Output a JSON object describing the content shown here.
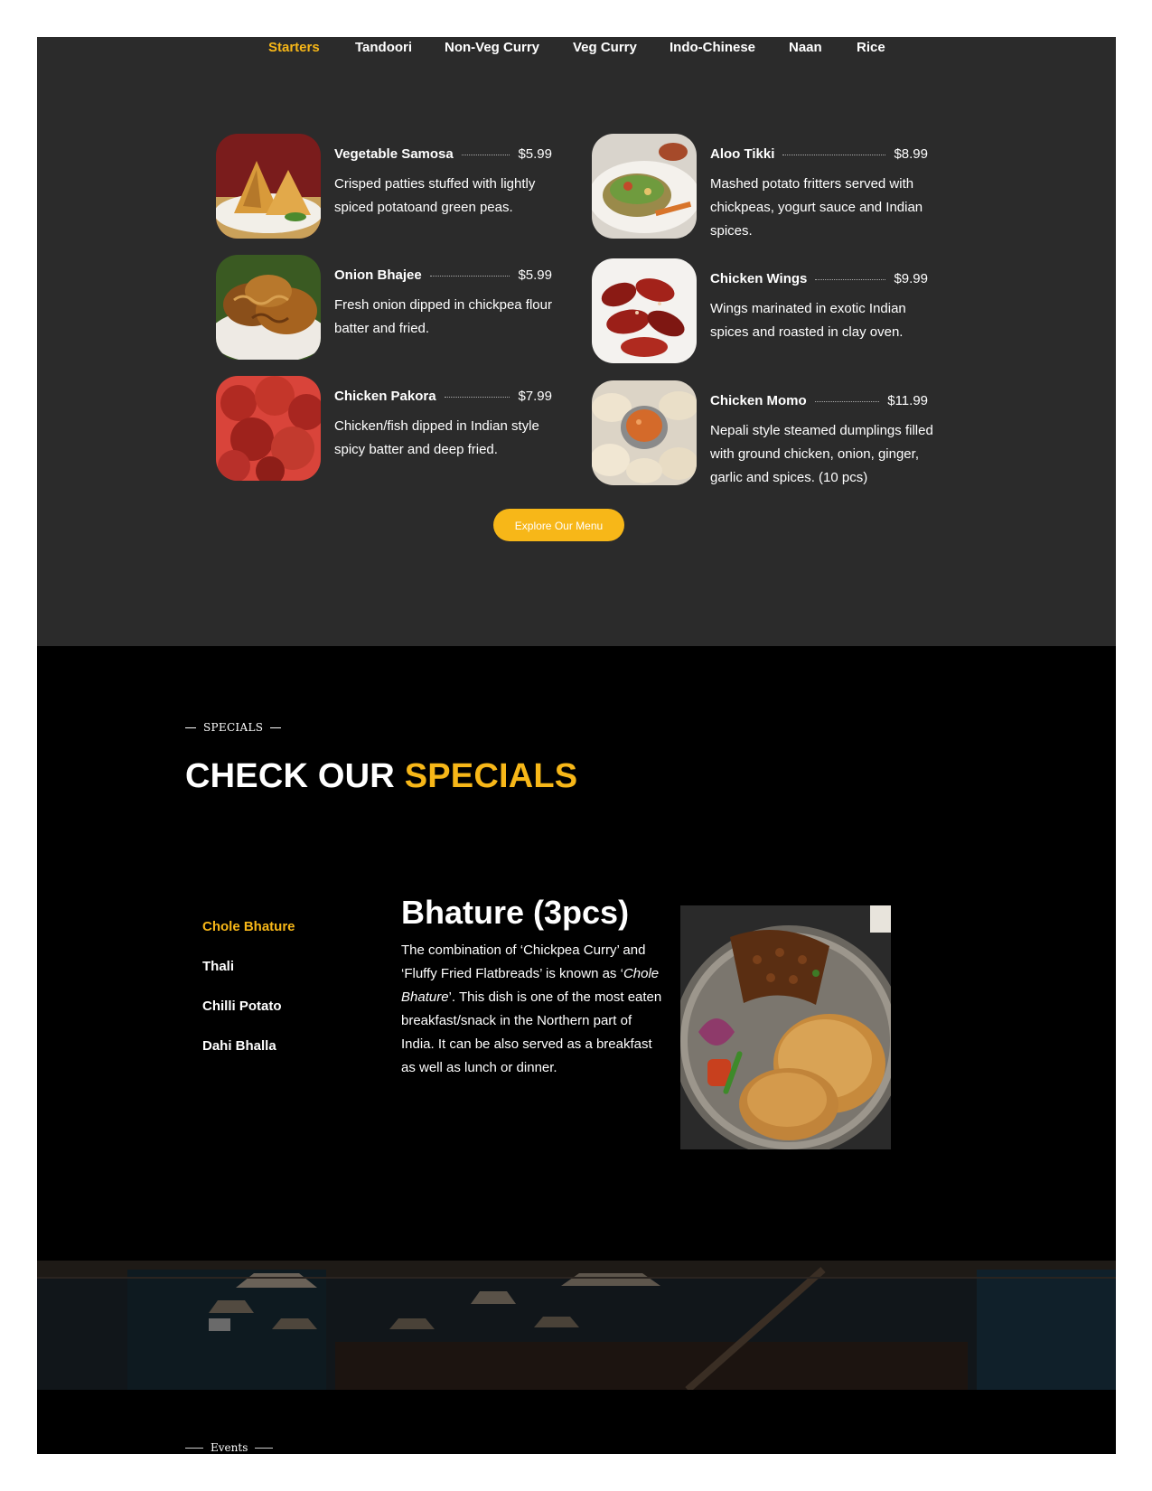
{
  "menu": {
    "tabs": [
      {
        "label": "Starters",
        "active": true
      },
      {
        "label": "Tandoori",
        "active": false
      },
      {
        "label": "Non-Veg Curry",
        "active": false
      },
      {
        "label": "Veg Curry",
        "active": false
      },
      {
        "label": "Indo-Chinese",
        "active": false
      },
      {
        "label": "Naan",
        "active": false
      },
      {
        "label": "Rice",
        "active": false
      }
    ],
    "items": [
      {
        "name": "Vegetable Samosa",
        "price": "$5.99",
        "desc": "Crisped patties stuffed with lightly spiced potatoand green peas.",
        "image": "samosa-photo"
      },
      {
        "name": "Aloo Tikki",
        "price": "$8.99",
        "desc": "Mashed potato fritters served with chickpeas, yogurt sauce and Indian spices.",
        "image": "aloo-tikki-photo"
      },
      {
        "name": "Onion Bhajee",
        "price": "$5.99",
        "desc": "Fresh onion dipped in chickpea flour batter and fried.",
        "image": "onion-bhajee-photo"
      },
      {
        "name": "Chicken Wings",
        "price": "$9.99",
        "desc": "Wings marinated in exotic Indian spices and roasted in clay oven.",
        "image": "chicken-wings-photo"
      },
      {
        "name": "Chicken Pakora",
        "price": "$7.99",
        "desc": "Chicken/fish dipped in Indian style spicy batter and deep fried.",
        "image": "chicken-pakora-photo"
      },
      {
        "name": "Chicken Momo",
        "price": "$11.99",
        "desc": "Nepali style steamed dumplings filled with ground chicken, onion, ginger, garlic and spices. (10 pcs)",
        "image": "chicken-momo-photo"
      }
    ],
    "explore_label": "Explore Our Menu"
  },
  "specials": {
    "kicker": "SPECIALS",
    "heading_part1": "CHECK OUR ",
    "heading_part2": "SPECIALS",
    "nav": [
      {
        "label": "Chole Bhature",
        "active": true
      },
      {
        "label": "Thali",
        "active": false
      },
      {
        "label": "Chilli Potato",
        "active": false
      },
      {
        "label": "Dahi Bhalla",
        "active": false
      }
    ],
    "dish_title": "Bhature (3pcs)",
    "dish_desc_1": "The combination of ‘Chickpea Curry’ and ‘Fluffy Fried Flatbreads’ is known as ‘",
    "dish_desc_italic": "Chole Bhature",
    "dish_desc_2": "’. This dish is one of the most eaten breakfast/snack in the Northern part of India. It can be also served as a breakfast as well as lunch or dinner.",
    "dish_image": "chole-bhature-photo"
  },
  "events": {
    "kicker": "Events",
    "background": "restaurant-interior-photo"
  },
  "colors": {
    "accent": "#f7b718",
    "menu_bg": "#2b2b2b",
    "specials_bg": "#000000"
  }
}
